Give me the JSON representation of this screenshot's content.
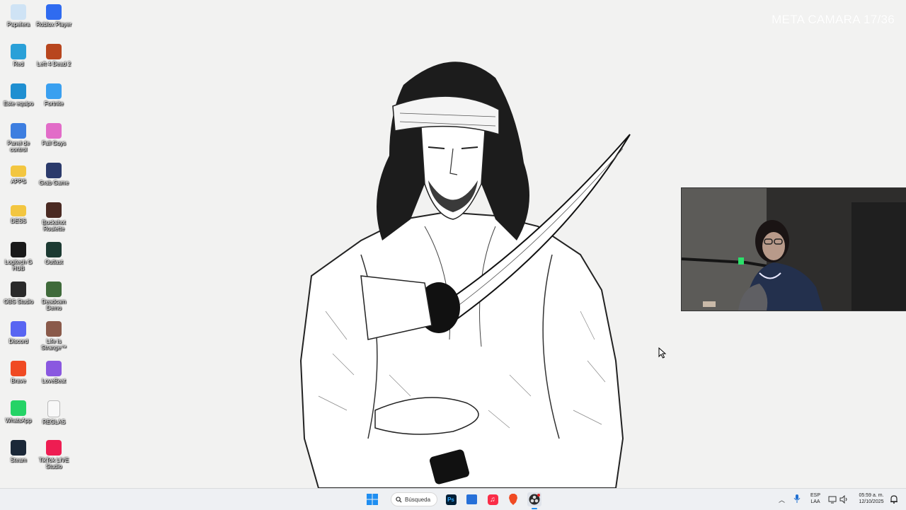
{
  "overlay": {
    "label": "META CAMARA 17/36"
  },
  "desktop_icons": [
    {
      "label": "Papelera",
      "icon": "recycle-bin-icon",
      "color": "#cfe3f5"
    },
    {
      "label": "Roblox Player",
      "icon": "roblox-icon",
      "color": "#2f6bf0"
    },
    {
      "label": "Red",
      "icon": "network-icon",
      "color": "#2aa0d8"
    },
    {
      "label": "Left 4 Dead 2",
      "icon": "left4dead-icon",
      "color": "#b8461e"
    },
    {
      "label": "Este equipo",
      "icon": "computer-icon",
      "color": "#1f8fd1"
    },
    {
      "label": "Fortnite",
      "icon": "fortnite-icon",
      "color": "#3aa0f0"
    },
    {
      "label": "Panel de control",
      "icon": "control-panel-icon",
      "color": "#3d7ee0"
    },
    {
      "label": "Fall Guys",
      "icon": "fall-guys-icon",
      "color": "#e26cc8"
    },
    {
      "label": "APPS",
      "icon": "folder-icon",
      "color": "#f3c640"
    },
    {
      "label": "Grab Game",
      "icon": "grab-game-icon",
      "color": "#2b3a6b"
    },
    {
      "label": "DESS",
      "icon": "folder-icon",
      "color": "#f3c640"
    },
    {
      "label": "Buckshot Roulette",
      "icon": "buckshot-icon",
      "color": "#4a2a22"
    },
    {
      "label": "Logitech G HUB",
      "icon": "logitech-icon",
      "color": "#1a1a1a"
    },
    {
      "label": "Outlast",
      "icon": "outlast-icon",
      "color": "#1c3a32"
    },
    {
      "label": "OBS Studio",
      "icon": "obs-icon",
      "color": "#2a2a2a"
    },
    {
      "label": "Deadcam Demo",
      "icon": "deadcam-icon",
      "color": "#3f6a3a"
    },
    {
      "label": "Discord",
      "icon": "discord-icon",
      "color": "#5865f2"
    },
    {
      "label": "Life is Strange™",
      "icon": "life-is-strange-icon",
      "color": "#8a5a4a"
    },
    {
      "label": "Brave",
      "icon": "brave-icon",
      "color": "#f04a23"
    },
    {
      "label": "LoveBeat",
      "icon": "lovebeat-icon",
      "color": "#8a58e0"
    },
    {
      "label": "WhatsApp",
      "icon": "whatsapp-icon",
      "color": "#25d366"
    },
    {
      "label": "REGLAS",
      "icon": "text-file-icon",
      "color": "#f8f8f8"
    },
    {
      "label": "Steam",
      "icon": "steam-icon",
      "color": "#1b2838"
    },
    {
      "label": "TikTok LIVE Studio",
      "icon": "tiktok-live-icon",
      "color": "#ee1d52"
    }
  ],
  "taskbar": {
    "search_label": "Búsqueda",
    "apps": [
      {
        "name": "start-button",
        "icon": "windows-icon",
        "color": "#1f8ef1"
      },
      {
        "name": "photoshop-button",
        "icon": "photoshop-icon",
        "color": "#001e36"
      },
      {
        "name": "store-button",
        "icon": "store-icon",
        "color": "#2770d8"
      },
      {
        "name": "music-button",
        "icon": "itunes-icon",
        "color": "#fa2d48"
      },
      {
        "name": "brave-button",
        "icon": "brave-icon",
        "color": "#f04a23"
      },
      {
        "name": "obs-button",
        "icon": "obs-icon",
        "color": "#2a2a2a"
      }
    ],
    "lang_top": "ESP",
    "lang_bottom": "LAA",
    "time": "05:59 a. m.",
    "date": "12/10/2025"
  }
}
